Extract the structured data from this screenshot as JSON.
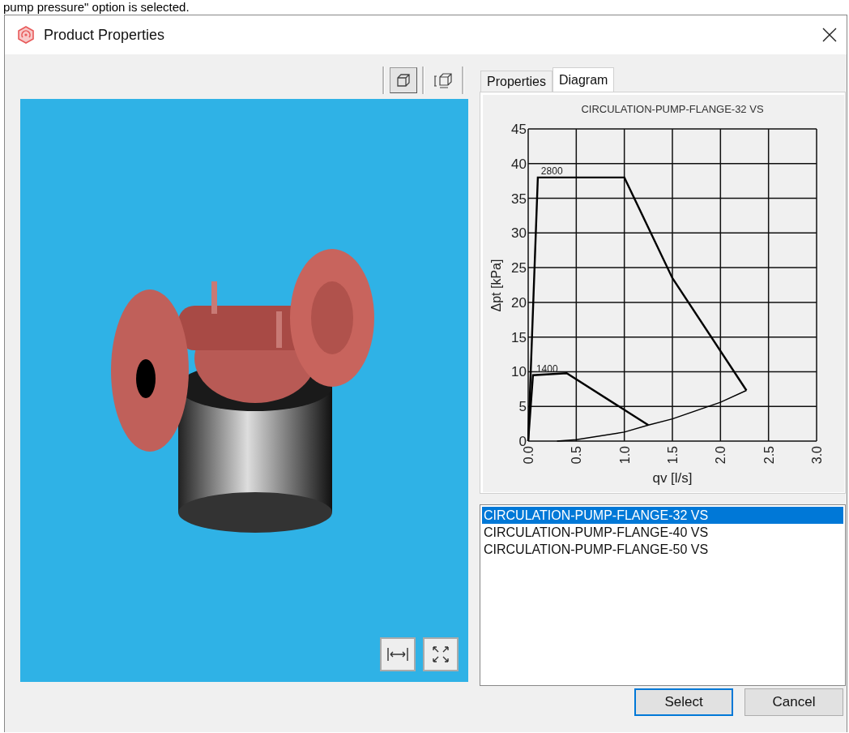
{
  "caption_above": "pump pressure\" option is selected.",
  "window": {
    "title": "Product Properties"
  },
  "view_buttons": [
    {
      "selected": true
    },
    {
      "selected": false
    }
  ],
  "tabs": [
    {
      "label": "Properties",
      "selected": false
    },
    {
      "label": "Diagram",
      "selected": true
    }
  ],
  "chart_data": {
    "type": "line",
    "title": "CIRCULATION-PUMP-FLANGE-32 VS",
    "xlabel": "qv [l/s]",
    "ylabel": "Δpt [kPa]",
    "x": [
      0,
      0.05,
      0.1,
      0.3,
      0.4,
      0.5,
      1.0,
      1.25,
      1.5,
      2.0,
      2.27
    ],
    "series": [
      {
        "name": "2800",
        "color": "#000000",
        "values": [
          0,
          null,
          38,
          null,
          null,
          null,
          38,
          null,
          23.5,
          null,
          7.3
        ]
      },
      {
        "name": "1400",
        "color": "#000000",
        "values": [
          0,
          9.5,
          null,
          null,
          9.8,
          null,
          null,
          2.3,
          null,
          null,
          null
        ]
      },
      {
        "color": "#000000",
        "values": [
          null,
          null,
          null,
          0,
          null,
          0.2,
          1.3,
          2.3,
          3.2,
          5.6,
          7.3
        ]
      }
    ],
    "grid": true,
    "xlim": [
      0,
      3
    ],
    "ylim": [
      0,
      45
    ],
    "xticks": [
      {
        "value": 0,
        "label": "0.0"
      },
      {
        "value": 0.5,
        "label": "0.5"
      },
      {
        "value": 1,
        "label": "1.0"
      },
      {
        "value": 1.5,
        "label": "1.5"
      },
      {
        "value": 2,
        "label": "2.0"
      },
      {
        "value": 2.5,
        "label": "2.5"
      },
      {
        "value": 3,
        "label": "3.0"
      }
    ],
    "yticks": [
      0,
      5,
      10,
      15,
      20,
      25,
      30,
      35,
      40,
      45
    ]
  },
  "product_list": [
    {
      "label": "CIRCULATION-PUMP-FLANGE-32 VS",
      "selected": true
    },
    {
      "label": "CIRCULATION-PUMP-FLANGE-40 VS",
      "selected": false
    },
    {
      "label": "CIRCULATION-PUMP-FLANGE-50 VS",
      "selected": false
    }
  ],
  "buttons": [
    {
      "label": "Select",
      "default": true
    },
    {
      "label": "Cancel",
      "default": false
    }
  ]
}
